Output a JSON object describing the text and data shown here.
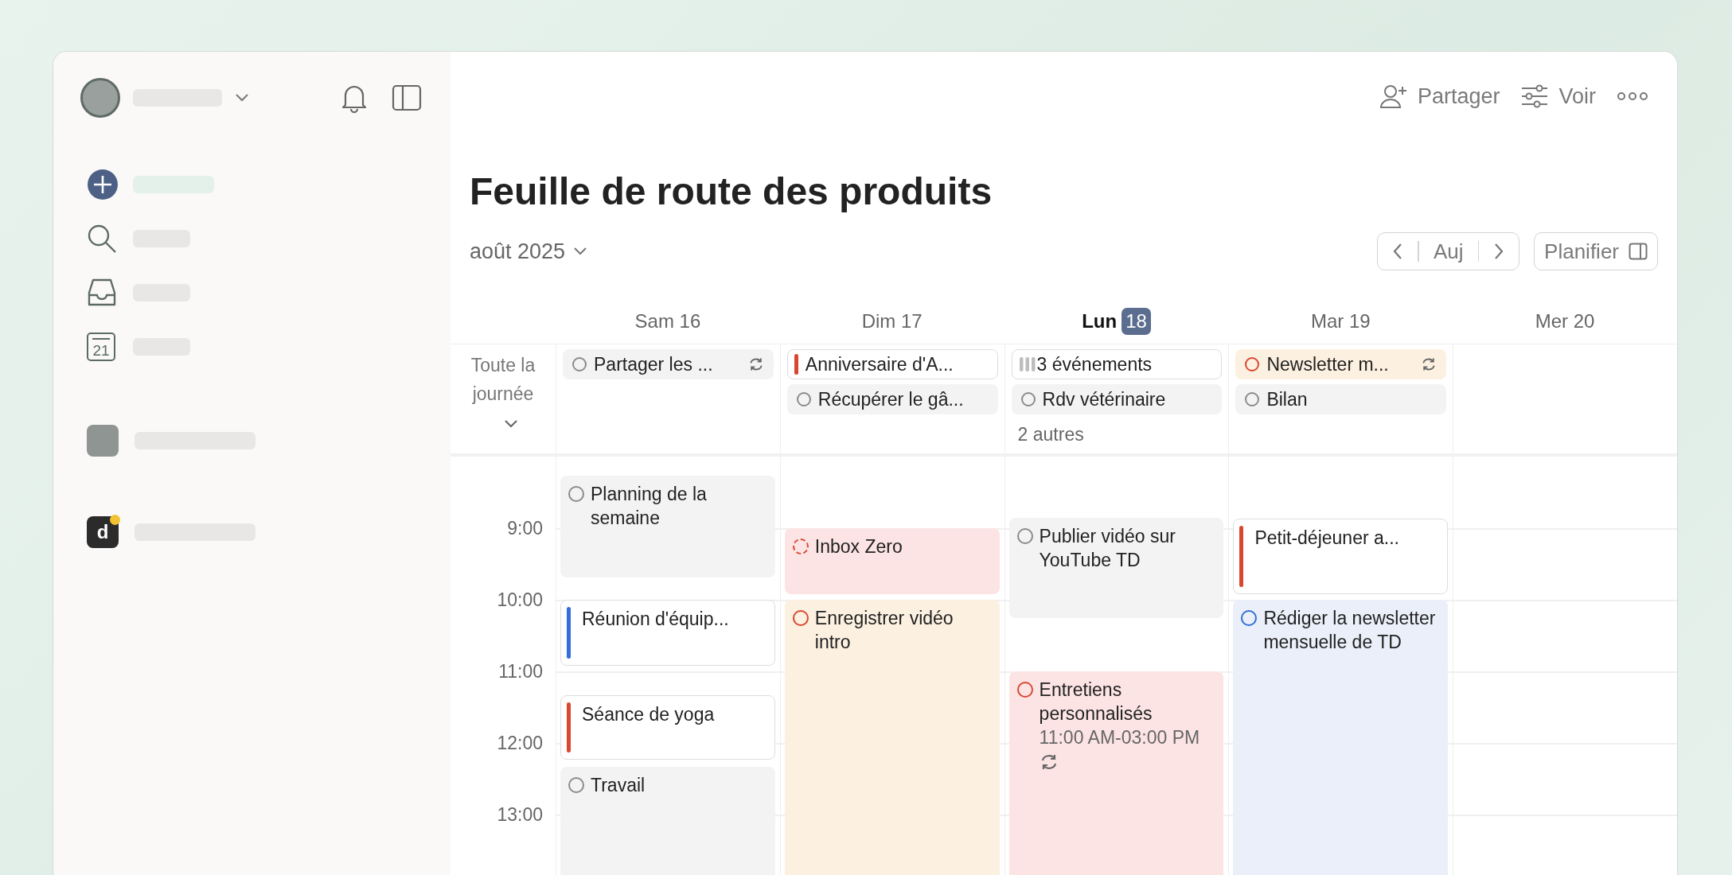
{
  "sidebar": {
    "calendar_icon_day": "21",
    "workspace_badge": "d"
  },
  "toolbar": {
    "share": "Partager",
    "view": "Voir"
  },
  "title": "Feuille de route des produits",
  "month": "août 2025",
  "nav": {
    "today": "Auj",
    "plan": "Planifier"
  },
  "all_day_label": "Toute la journée",
  "hours": [
    "9:00",
    "10:00",
    "11:00",
    "12:00",
    "13:00"
  ],
  "days": [
    {
      "weekday": "Sam",
      "date": "16",
      "selected": false,
      "all_day": [
        {
          "kind": "task",
          "title": "Partager les ...",
          "color": "#f4f3f3",
          "recurring": true
        }
      ],
      "events": [
        {
          "kind": "task",
          "title": "Planning de la semaine",
          "color": "#f4f3f3"
        },
        {
          "kind": "event",
          "title": "Réunion d'équip...",
          "color": "#2f6fd6"
        },
        {
          "kind": "event",
          "title": "Séance de yoga",
          "color": "#d9472f"
        },
        {
          "kind": "task",
          "title": "Travail",
          "color": "#f4f3f3"
        }
      ]
    },
    {
      "weekday": "Dim",
      "date": "17",
      "selected": false,
      "all_day": [
        {
          "kind": "event",
          "title": "Anniversaire d'A...",
          "color": "#d9472f"
        },
        {
          "kind": "task",
          "title": "Récupérer le gâ...",
          "color": "#f4f3f3"
        }
      ],
      "events": [
        {
          "kind": "task",
          "title": "Inbox Zero",
          "color": "#fde4e4",
          "dashed": true
        },
        {
          "kind": "task",
          "title": "Enregistrer vidéo intro",
          "color": "#fcf0e0"
        }
      ]
    },
    {
      "weekday": "Lun",
      "date": "18",
      "selected": true,
      "all_day": [
        {
          "kind": "group",
          "title": "3 événements",
          "color": "#bdbdbd"
        },
        {
          "kind": "task",
          "title": "Rdv vétérinaire",
          "color": "#f4f3f3"
        }
      ],
      "more": "2 autres",
      "events": [
        {
          "kind": "task",
          "title": "Publier vidéo sur YouTube TD",
          "color": "#f4f3f3"
        },
        {
          "kind": "task",
          "title": "Entretiens personnalisés",
          "color": "#fde4e4",
          "time": "11:00 AM-03:00 PM",
          "recurring": true
        }
      ]
    },
    {
      "weekday": "Mar",
      "date": "19",
      "selected": false,
      "all_day": [
        {
          "kind": "task",
          "title": "Newsletter m...",
          "color": "#fcf0e0",
          "recurring": true
        },
        {
          "kind": "task",
          "title": "Bilan",
          "color": "#f4f3f3"
        }
      ],
      "events": [
        {
          "kind": "event",
          "title": "Petit-déjeuner a...",
          "color": "#d9472f"
        },
        {
          "kind": "task",
          "title": "Rédiger la newsletter mensuelle de TD",
          "color": "#ebeff9"
        }
      ]
    },
    {
      "weekday": "Mer",
      "date": "20",
      "selected": false
    }
  ]
}
